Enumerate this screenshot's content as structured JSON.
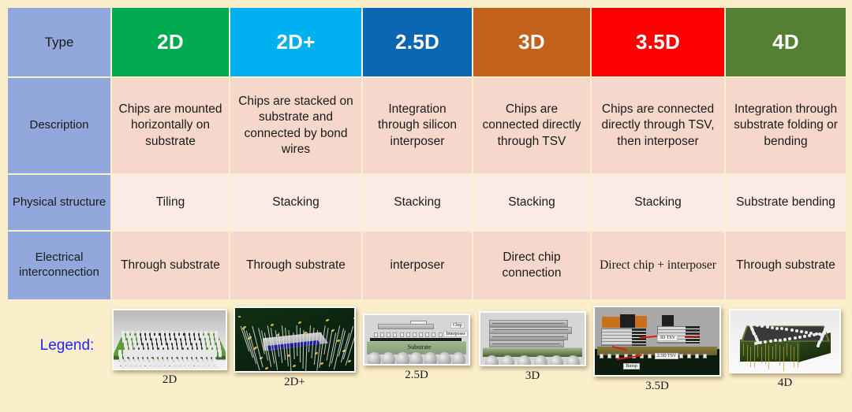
{
  "theme": {
    "background": "#faeecb",
    "row_label_bg": "#92a8dd",
    "desc_cell_bg": "#f6d7cb",
    "phys_cell_bg": "#fbeae6",
    "legend_title_color": "#2323ff"
  },
  "table": {
    "header": {
      "row_label": "Type",
      "columns": [
        {
          "label": "2D",
          "color": "#00a84f"
        },
        {
          "label": "2D+",
          "color": "#00b0f0"
        },
        {
          "label": "2.5D",
          "color": "#0b67b2"
        },
        {
          "label": "3D",
          "color": "#c2611a"
        },
        {
          "label": "3.5D",
          "color": "#fe0000"
        },
        {
          "label": "4D",
          "color": "#558034"
        }
      ]
    },
    "rows": [
      {
        "label": "Description",
        "cells": [
          "Chips are mounted horizontally on substrate",
          "Chips are stacked on substrate and connected by bond wires",
          "Integration through silicon interposer",
          "Chips are connected directly through TSV",
          "Chips are connected directly through TSV, then interposer",
          "Integration through substrate folding or bending"
        ]
      },
      {
        "label": "Physical structure",
        "cells": [
          "Tiling",
          "Stacking",
          "Stacking",
          "Stacking",
          "Stacking",
          "Substrate bending"
        ]
      },
      {
        "label": "Electrical interconnection",
        "cells": [
          "Through substrate",
          "Through substrate",
          "interposer",
          "Direct chip connection",
          "Direct chip + interposer",
          "Through substrate"
        ]
      }
    ]
  },
  "legend": {
    "title": "Legend:",
    "items": [
      {
        "caption": "2D",
        "art": "bga-top-view"
      },
      {
        "caption": "2D+",
        "art": "wire-bond-stack"
      },
      {
        "caption": "2.5D",
        "art": "interposer-cross-section",
        "inline_labels": [
          "Chip",
          "Interposer",
          "Substrate"
        ]
      },
      {
        "caption": "3D",
        "art": "stacked-die-cross-section"
      },
      {
        "caption": "3.5D",
        "art": "tsv-interposer-3d-view",
        "inline_labels": [
          "3D TSV",
          "2.5D TSV",
          "Bump"
        ]
      },
      {
        "caption": "4D",
        "art": "folded-substrate-block"
      }
    ]
  }
}
